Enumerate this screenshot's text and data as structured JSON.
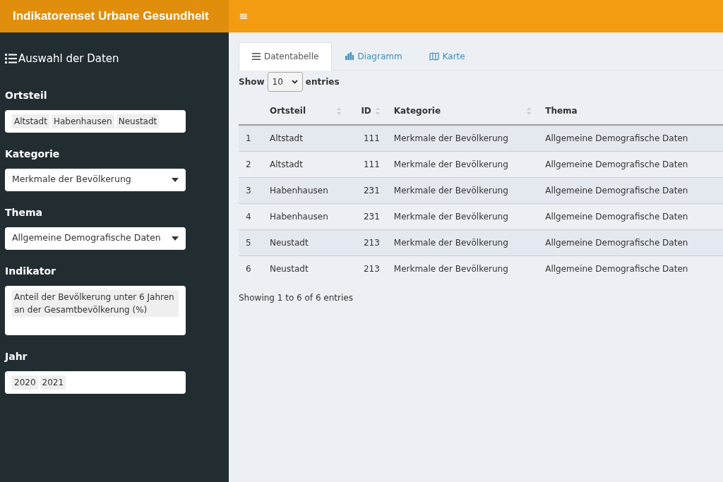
{
  "header": {
    "title": "Indikatorenset Urbane Gesundheit",
    "menu_toggle": "≡"
  },
  "sidebar": {
    "heading": "Auswahl der Daten",
    "filters": [
      {
        "label": "Ortsteil",
        "kind": "multi",
        "values": [
          "Altstadt",
          "Habenhausen",
          "Neustadt"
        ]
      },
      {
        "label": "Kategorie",
        "kind": "select",
        "values": [
          "Merkmale der Bevölkerung"
        ]
      },
      {
        "label": "Thema",
        "kind": "select",
        "values": [
          "Allgemeine Demografische Daten"
        ]
      },
      {
        "label": "Indikator",
        "kind": "multi",
        "values": [
          "Anteil der Bevölkerung unter 6 Jahren an der Gesamtbevölkerung (%)"
        ]
      },
      {
        "label": "Jahr",
        "kind": "multi",
        "values": [
          "2020",
          "2021"
        ]
      }
    ]
  },
  "tabs": [
    {
      "label": "Datentabelle",
      "selected": true
    },
    {
      "label": "Diagramm",
      "selected": false
    },
    {
      "label": "Karte",
      "selected": false
    }
  ],
  "length_menu": {
    "before": "Show",
    "value": "10",
    "after": "entries"
  },
  "table": {
    "columns": [
      {
        "sortable": false
      },
      {
        "label": "Ortsteil",
        "sortable": true
      },
      {
        "label": "ID",
        "sortable": true
      },
      {
        "label": "Kategorie",
        "sortable": true
      },
      {
        "label": "Thema",
        "sortable": false
      }
    ],
    "rows": [
      [
        "1",
        "Altstadt",
        "111",
        "Merkmale der Bevölkerung",
        "Allgemeine Demografische Daten"
      ],
      [
        "2",
        "Altstadt",
        "111",
        "Merkmale der Bevölkerung",
        "Allgemeine Demografische Daten"
      ],
      [
        "3",
        "Habenhausen",
        "231",
        "Merkmale der Bevölkerung",
        "Allgemeine Demografische Daten"
      ],
      [
        "4",
        "Habenhausen",
        "231",
        "Merkmale der Bevölkerung",
        "Allgemeine Demografische Daten"
      ],
      [
        "5",
        "Neustadt",
        "213",
        "Merkmale der Bevölkerung",
        "Allgemeine Demografische Daten"
      ],
      [
        "6",
        "Neustadt",
        "213",
        "Merkmale der Bevölkerung",
        "Allgemeine Demografische Daten"
      ]
    ]
  },
  "info": "Showing 1 to 6 of 6 entries"
}
